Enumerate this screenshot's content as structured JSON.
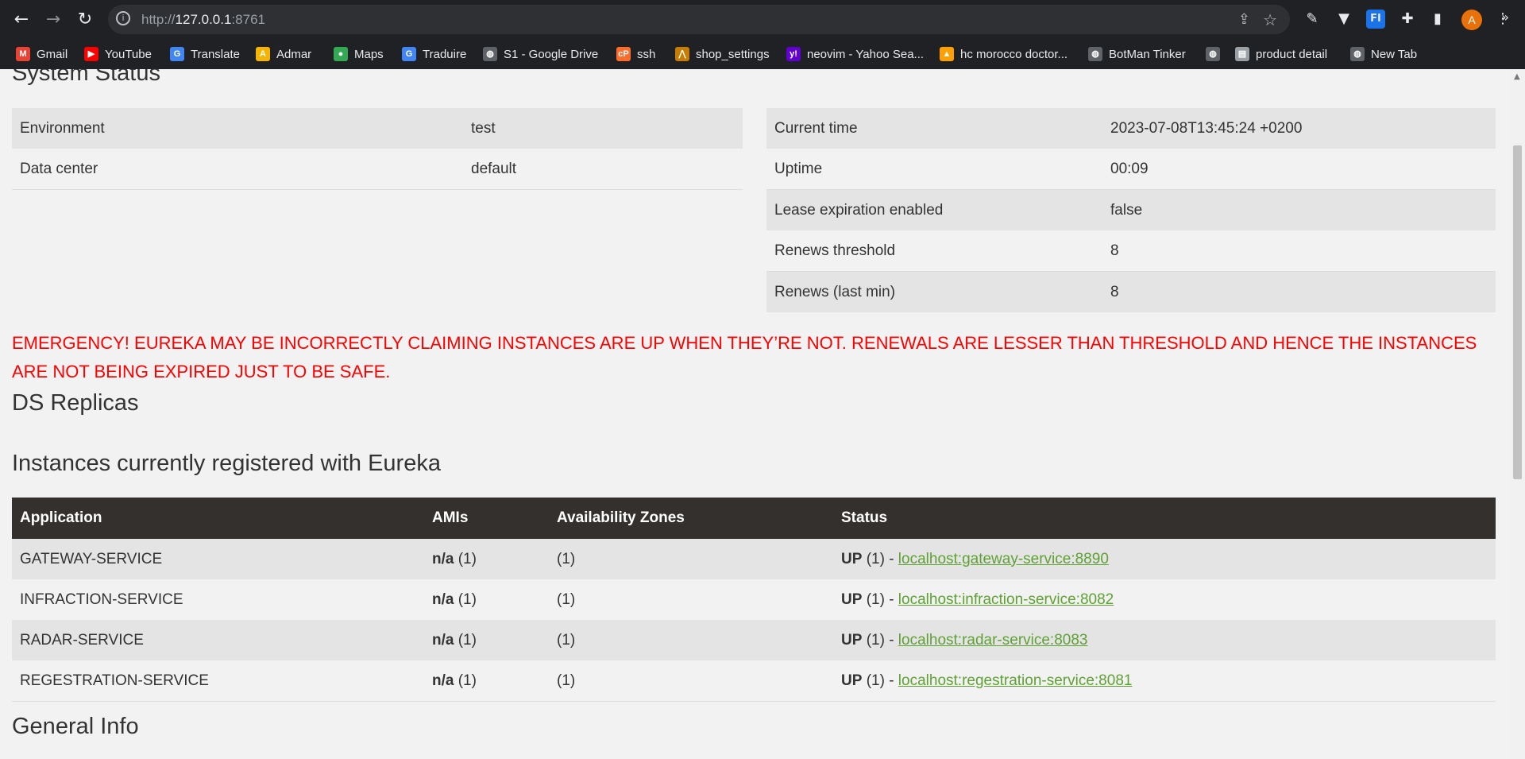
{
  "browser": {
    "url_prefix": "http://",
    "url_host": "127.0.0.1",
    "url_port": ":8761",
    "avatar_letter": "A",
    "bookmarks": [
      {
        "label": "Gmail",
        "icon": "gmail-icon"
      },
      {
        "label": "YouTube",
        "icon": "youtube-icon"
      },
      {
        "label": "Translate",
        "icon": "translate-icon"
      },
      {
        "label": "Admar",
        "icon": "admar-icon"
      },
      {
        "label": "Maps",
        "icon": "maps-icon"
      },
      {
        "label": "Traduire",
        "icon": "translate-icon"
      },
      {
        "label": "S1 - Google Drive",
        "icon": "globe-icon"
      },
      {
        "label": "ssh",
        "icon": "cpanel-icon"
      },
      {
        "label": "shop_settings",
        "icon": "shop-icon"
      },
      {
        "label": "neovim - Yahoo Sea...",
        "icon": "yahoo-icon"
      },
      {
        "label": "hc morocco doctor...",
        "icon": "firebase-icon"
      },
      {
        "label": "BotMan Tinker",
        "icon": "globe-icon"
      },
      {
        "label": "",
        "icon": "globe-icon"
      },
      {
        "label": "product detail",
        "icon": "page-icon"
      },
      {
        "label": "New Tab",
        "icon": "globe-icon"
      }
    ]
  },
  "system_status": {
    "title": "System Status",
    "left": [
      {
        "key": "Environment",
        "value": "test"
      },
      {
        "key": "Data center",
        "value": "default"
      }
    ],
    "right": [
      {
        "key": "Current time",
        "value": "2023-07-08T13:45:24 +0200"
      },
      {
        "key": "Uptime",
        "value": "00:09"
      },
      {
        "key": "Lease expiration enabled",
        "value": "false"
      },
      {
        "key": "Renews threshold",
        "value": "8"
      },
      {
        "key": "Renews (last min)",
        "value": "8"
      }
    ]
  },
  "emergency": "EMERGENCY! EUREKA MAY BE INCORRECTLY CLAIMING INSTANCES ARE UP WHEN THEY’RE NOT. RENEWALS ARE LESSER THAN THRESHOLD AND HENCE THE INSTANCES ARE NOT BEING EXPIRED JUST TO BE SAFE.",
  "replicas_title": "DS Replicas",
  "instances": {
    "title": "Instances currently registered with Eureka",
    "headers": [
      "Application",
      "AMIs",
      "Availability Zones",
      "Status"
    ],
    "rows": [
      {
        "app": "GATEWAY-SERVICE",
        "ami": "n/a",
        "ami_count": "(1)",
        "zones": "(1)",
        "status": "UP",
        "status_count": "(1) -",
        "link": "localhost:gateway-service:8890"
      },
      {
        "app": "INFRACTION-SERVICE",
        "ami": "n/a",
        "ami_count": "(1)",
        "zones": "(1)",
        "status": "UP",
        "status_count": "(1) -",
        "link": "localhost:infraction-service:8082"
      },
      {
        "app": "RADAR-SERVICE",
        "ami": "n/a",
        "ami_count": "(1)",
        "zones": "(1)",
        "status": "UP",
        "status_count": "(1) -",
        "link": "localhost:radar-service:8083"
      },
      {
        "app": "REGESTRATION-SERVICE",
        "ami": "n/a",
        "ami_count": "(1)",
        "zones": "(1)",
        "status": "UP",
        "status_count": "(1) -",
        "link": "localhost:regestration-service:8081"
      }
    ]
  },
  "general_info_title": "General Info"
}
